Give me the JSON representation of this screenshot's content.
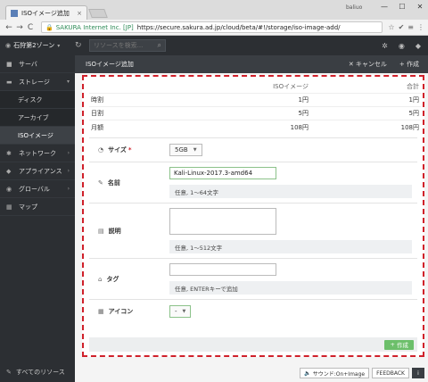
{
  "browser": {
    "tab_title": "ISOイメージ追加",
    "tab_close": "×",
    "user_chip": "baliuo",
    "window_controls": [
      "—",
      "☐",
      "✕"
    ],
    "nav": {
      "back": "←",
      "forward": "→",
      "reload": "C"
    },
    "site_identity": "SAKURA Internet Inc. [JP]",
    "url": "https://secure.sakura.ad.jp/cloud/beta/#!/storage/iso-image-add/",
    "icons": [
      "☆",
      "✔",
      "≡",
      "⋮"
    ]
  },
  "appbar": {
    "zone": "石狩第2ゾーン",
    "search_placeholder": "リソースを検索...",
    "right_icons": [
      "✲",
      "◉",
      "◆"
    ]
  },
  "sidebar": {
    "items": [
      {
        "label": "サーバ",
        "icon": "■"
      },
      {
        "label": "ストレージ",
        "icon": "▬",
        "chevron": "▾"
      },
      {
        "label": "ディスク"
      },
      {
        "label": "アーカイブ"
      },
      {
        "label": "ISOイメージ"
      },
      {
        "label": "ネットワーク",
        "icon": "✱",
        "chevron": "›"
      },
      {
        "label": "アプライアンス",
        "icon": "◆",
        "chevron": "›"
      },
      {
        "label": "グローバル",
        "icon": "◉",
        "chevron": "›"
      },
      {
        "label": "マップ",
        "icon": "▦"
      }
    ],
    "footer": "すべてのリソース"
  },
  "main": {
    "title": "ISOイメージ追加",
    "cancel": "キャンセル",
    "create_header": "作成"
  },
  "pricing": {
    "headers": [
      "",
      "ISOイメージ",
      "合計"
    ],
    "rows": [
      [
        "時割",
        "1円",
        "1円"
      ],
      [
        "日割",
        "5円",
        "5円"
      ],
      [
        "月額",
        "108円",
        "108円"
      ]
    ]
  },
  "form": {
    "size": {
      "label": "サイズ",
      "required": "*",
      "value": "5GB"
    },
    "name": {
      "label": "名前",
      "value": "Kali-Linux-2017.3-amd64",
      "hint": "任意, 1〜64文字"
    },
    "description": {
      "label": "説明",
      "value": "",
      "hint": "任意, 1〜512文字"
    },
    "tags": {
      "label": "タグ",
      "value": "",
      "hint": "任意, ENTERキーで追加"
    },
    "icon": {
      "label": "アイコン",
      "value": "-"
    },
    "create_button": "作成"
  },
  "statusbar": {
    "sound": "サウンド:On+Image",
    "feedback": "FEEDBACK",
    "info": "i"
  }
}
